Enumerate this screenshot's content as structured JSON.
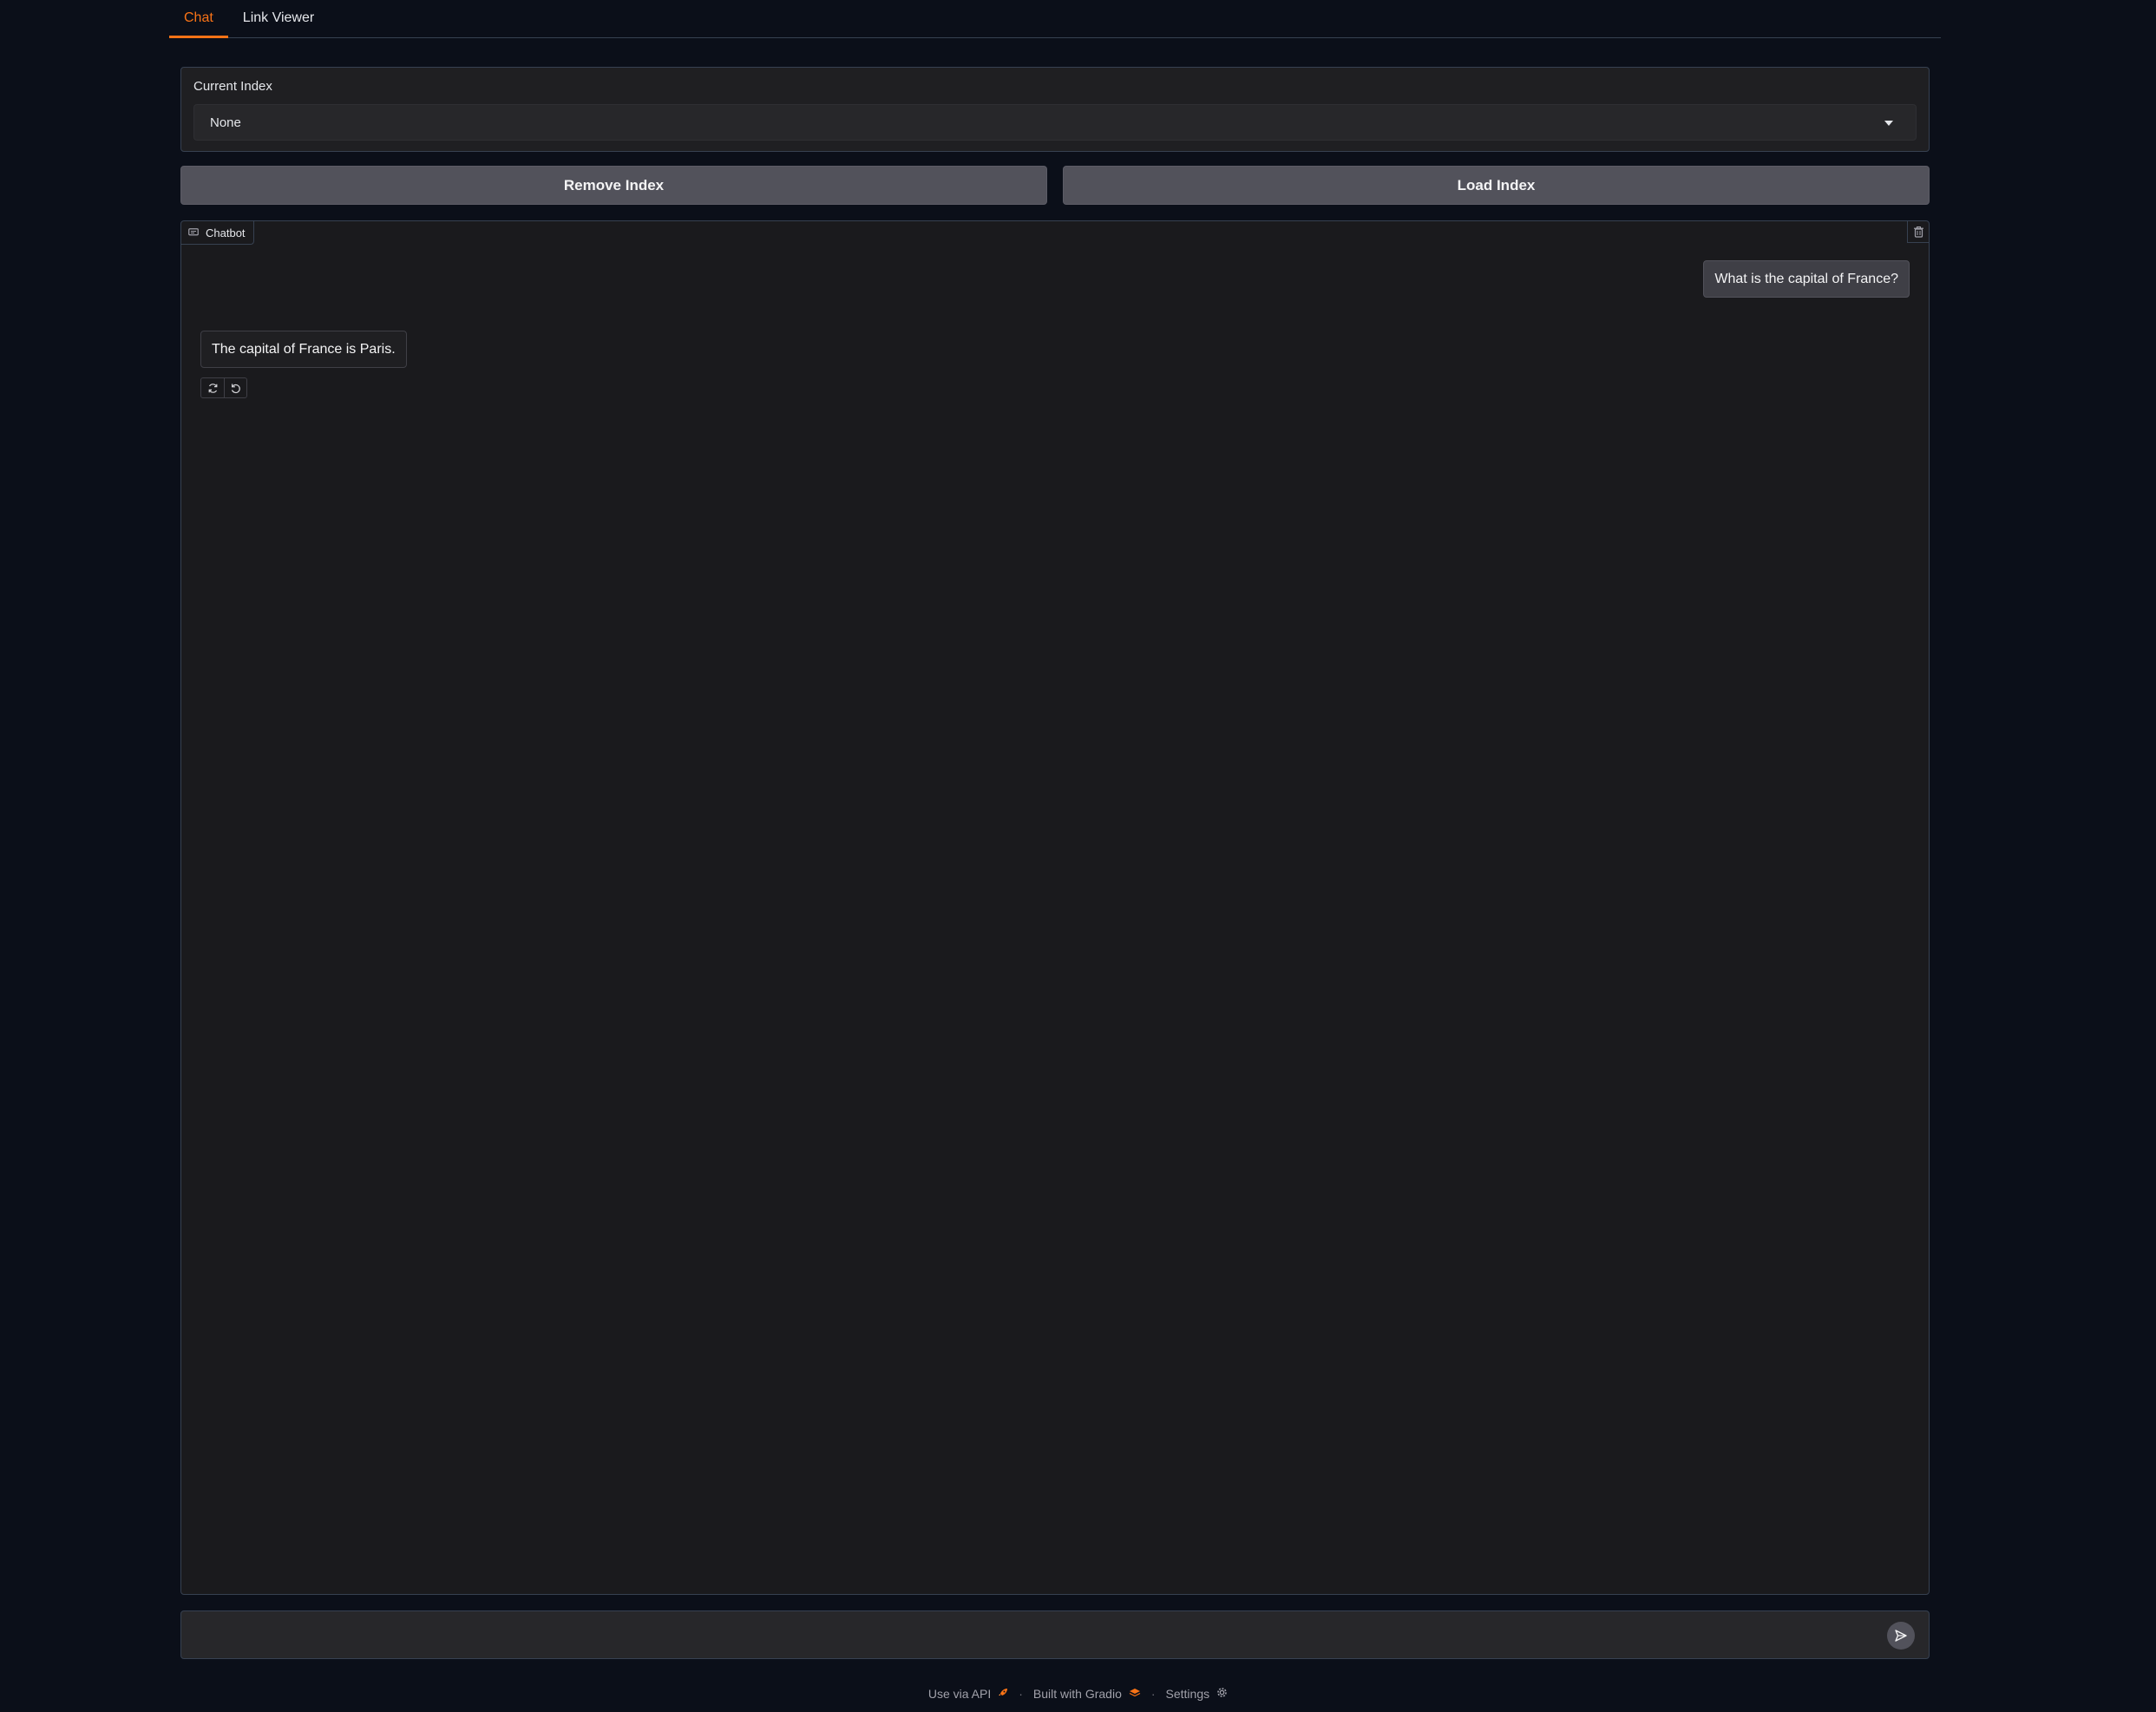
{
  "tabs": [
    {
      "label": "Chat",
      "active": true
    },
    {
      "label": "Link Viewer",
      "active": false
    }
  ],
  "index": {
    "label": "Current Index",
    "selected": "None"
  },
  "buttons": {
    "remove": "Remove Index",
    "load": "Load Index"
  },
  "chatbot": {
    "label": "Chatbot",
    "messages": [
      {
        "role": "user",
        "text": "What is the capital of France?"
      },
      {
        "role": "bot",
        "text": "The capital of France is Paris."
      }
    ]
  },
  "input": {
    "placeholder": ""
  },
  "footer": {
    "api": "Use via API",
    "built": "Built with Gradio",
    "settings": "Settings",
    "separator": "·"
  },
  "colors": {
    "accent": "#f97316",
    "background": "#0b0f19"
  },
  "icons": [
    "chat-icon",
    "trash-icon",
    "retry-icon",
    "undo-icon",
    "send-icon",
    "rocket-icon",
    "gradio-logo-icon",
    "gear-icon",
    "chevron-down-icon"
  ]
}
